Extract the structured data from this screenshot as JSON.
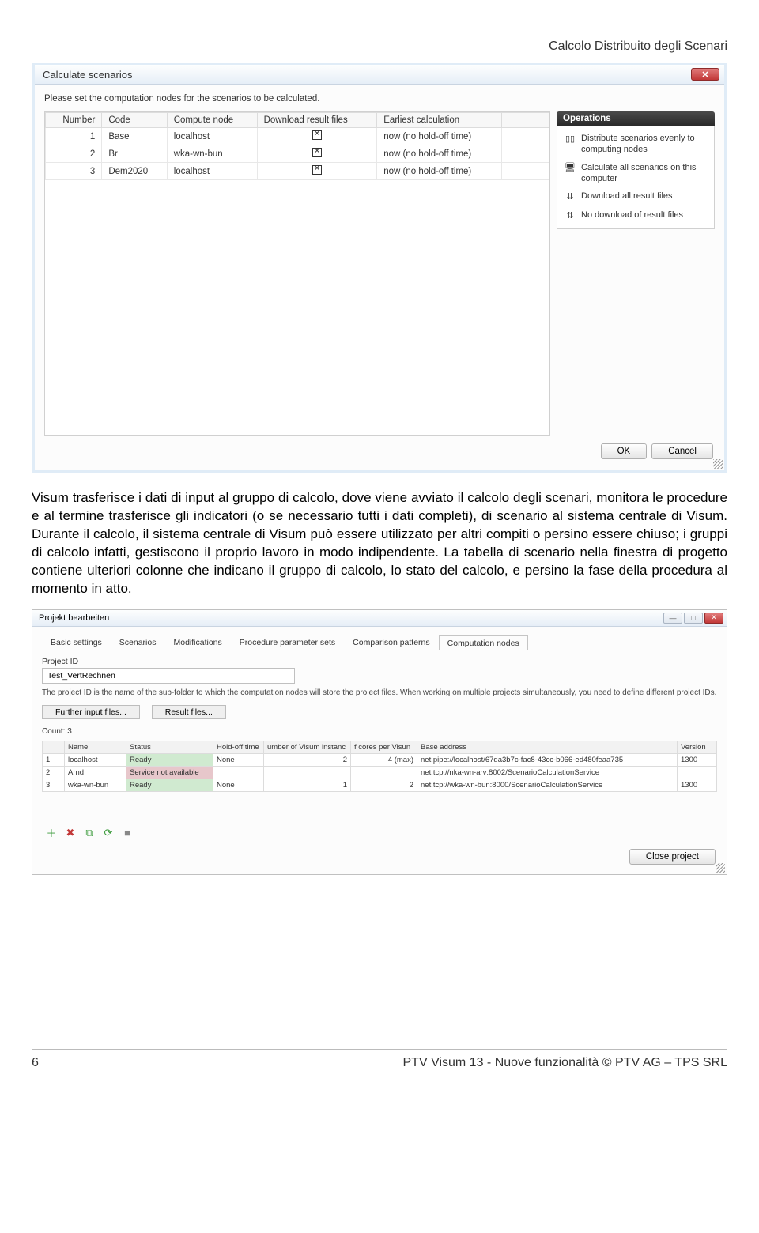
{
  "header": {
    "title": "Calcolo Distribuito degli Scenari"
  },
  "dialog1": {
    "title": "Calculate scenarios",
    "instruction": "Please set the computation nodes for the scenarios to be calculated.",
    "columns": [
      "Number",
      "Code",
      "Compute node",
      "Download result files",
      "Earliest calculation"
    ],
    "rows": [
      {
        "number": "1",
        "code": "Base",
        "node": "localhost",
        "earliest": "now (no hold-off time)"
      },
      {
        "number": "2",
        "code": "Br",
        "node": "wka-wn-bun",
        "earliest": "now (no hold-off time)"
      },
      {
        "number": "3",
        "code": "Dem2020",
        "node": "localhost",
        "earliest": "now (no hold-off time)"
      }
    ],
    "operations": {
      "header": "Operations",
      "items": [
        "Distribute scenarios evenly to computing nodes",
        "Calculate all scenarios on this computer",
        "Download all result files",
        "No download of result files"
      ]
    },
    "ok": "OK",
    "cancel": "Cancel"
  },
  "body_text": "Visum trasferisce i dati di input al gruppo di calcolo, dove viene avviato il calcolo degli scenari, monitora le procedure e al termine trasferisce gli indicatori (o se necessario tutti i dati completi), di scenario al sistema centrale di Visum. Durante il calcolo, il sistema centrale di Visum può essere utilizzato per altri compiti o persino essere chiuso; i gruppi di calcolo infatti, gestiscono il proprio lavoro in modo indipendente. La tabella di scenario nella finestra di progetto contiene ulteriori colonne che indicano il gruppo di calcolo, lo stato del calcolo, e persino la fase della procedura al momento in atto.",
  "dialog2": {
    "title": "Projekt bearbeiten",
    "tabs": [
      "Basic settings",
      "Scenarios",
      "Modifications",
      "Procedure parameter sets",
      "Comparison patterns",
      "Computation nodes"
    ],
    "project_id_label": "Project ID",
    "project_id_value": "Test_VertRechnen",
    "hint": "The project ID is the name of the sub-folder to which the computation nodes will store the project files. When working on multiple projects simultaneously, you need to define different project IDs.",
    "further_input": "Further input files...",
    "result_files": "Result files...",
    "count_label": "Count: 3",
    "columns": [
      "",
      "Name",
      "Status",
      "Hold-off time",
      "umber of Visum instanc",
      "f cores per Visun",
      "Base address",
      "Version"
    ],
    "rows": [
      {
        "idx": "1",
        "name": "localhost",
        "status": "Ready",
        "status_class": "ready",
        "hold": "None",
        "inst": "2",
        "cores": "4 (max)",
        "addr": "net.pipe://localhost/67da3b7c-fac8-43cc-b066-ed480feaa735",
        "ver": "1300"
      },
      {
        "idx": "2",
        "name": "Arnd",
        "status": "Service not available",
        "status_class": "unavail",
        "hold": "",
        "inst": "",
        "cores": "",
        "addr": "net.tcp://nka-wn-arv:8002/ScenarioCalculationService",
        "ver": ""
      },
      {
        "idx": "3",
        "name": "wka-wn-bun",
        "status": "Ready",
        "status_class": "ready",
        "hold": "None",
        "inst": "1",
        "cores": "2",
        "addr": "net.tcp://wka-wn-bun:8000/ScenarioCalculationService",
        "ver": "1300"
      }
    ],
    "close_project": "Close project"
  },
  "footer": {
    "page": "6",
    "right": "PTV Visum 13 - Nuove funzionalità © PTV AG – TPS SRL"
  }
}
